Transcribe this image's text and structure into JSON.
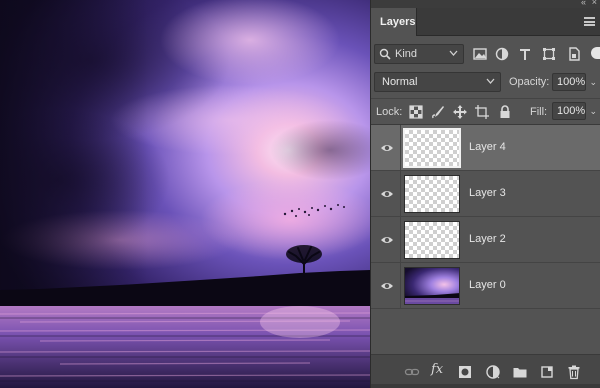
{
  "panel": {
    "tab_label": "Layers",
    "filter": {
      "kind_label": "Kind",
      "icons": [
        "pixel-filter-icon",
        "adjustment-filter-icon",
        "type-filter-icon",
        "shape-filter-icon",
        "smart-object-filter-icon",
        "filter-toggle"
      ]
    },
    "blend": {
      "mode": "Normal",
      "opacity_label": "Opacity:",
      "opacity_value": "100%"
    },
    "lock": {
      "label": "Lock:",
      "icons": [
        "lock-transparent-pixels-icon",
        "lock-image-pixels-icon",
        "lock-position-icon",
        "lock-artboard-icon",
        "lock-all-icon"
      ],
      "fill_label": "Fill:",
      "fill_value": "100%"
    },
    "layers": [
      {
        "name": "Layer 4",
        "visible": true,
        "selected": true,
        "thumbnail": "transparent"
      },
      {
        "name": "Layer 3",
        "visible": true,
        "selected": false,
        "thumbnail": "transparent"
      },
      {
        "name": "Layer 2",
        "visible": true,
        "selected": false,
        "thumbnail": "transparent"
      },
      {
        "name": "Layer 0",
        "visible": true,
        "selected": false,
        "thumbnail": "sunset-image"
      }
    ],
    "bottom_icons": [
      "link-layers-icon",
      "fx-icon",
      "add-mask-icon",
      "adjustment-layer-icon",
      "new-group-icon",
      "new-layer-icon",
      "delete-layer-icon"
    ],
    "fx_label": "fx"
  },
  "colors": {
    "panel_bg": "#535353",
    "selected_row": "#6a6a6a",
    "sky_purple": "#8a6fd8",
    "sky_pink": "#f0a8d8"
  }
}
